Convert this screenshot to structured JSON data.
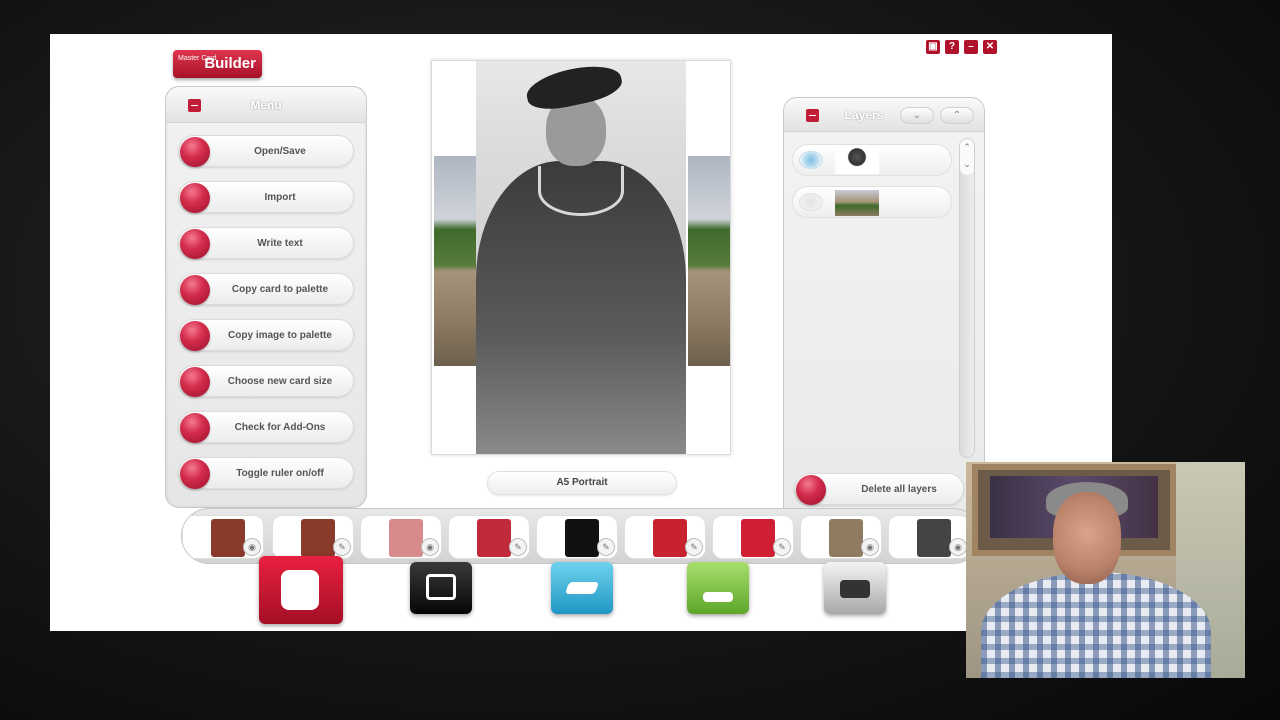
{
  "app": {
    "logo": {
      "small": "Master Card",
      "main": "Builder"
    },
    "window_controls": [
      "screen-icon",
      "help-icon",
      "minimize-icon",
      "close-icon"
    ]
  },
  "menu": {
    "title": "Menu",
    "items": [
      {
        "label": "Open/Save"
      },
      {
        "label": "Import"
      },
      {
        "label": "Write text"
      },
      {
        "label": "Copy card to palette"
      },
      {
        "label": "Copy image to palette"
      },
      {
        "label": "Choose new card size"
      },
      {
        "label": "Check for Add-Ons"
      },
      {
        "label": "Toggle ruler on/off"
      }
    ]
  },
  "canvas": {
    "size_label": "A5 Portrait"
  },
  "layers": {
    "title": "Layers",
    "items": [
      {
        "name": "sailor-boy-layer",
        "visible": true
      },
      {
        "name": "tower-background-layer",
        "visible": false
      }
    ],
    "delete_label": "Delete all layers"
  },
  "palette": {
    "items": [
      {
        "icon": "camera-icon",
        "color": "#8a3a2a"
      },
      {
        "icon": "pencil-icon",
        "color": "#8a3a2a"
      },
      {
        "icon": "camera-icon",
        "color": "#d98a8a"
      },
      {
        "icon": "pencil-icon",
        "color": "#c02a3a"
      },
      {
        "icon": "pencil-icon",
        "color": "#111111"
      },
      {
        "icon": "pencil-icon",
        "color": "#c8222e"
      },
      {
        "icon": "pencil-icon",
        "color": "#d01f34"
      },
      {
        "icon": "camera-icon",
        "color": "#8e7b62"
      },
      {
        "icon": "camera-icon",
        "color": "#444444"
      }
    ]
  },
  "tools": [
    {
      "name": "card-tool",
      "color": "#c7142f"
    },
    {
      "name": "frame-tool",
      "color": "#111111"
    },
    {
      "name": "brush-tool",
      "color": "#3eb2d6"
    },
    {
      "name": "stamp-tool",
      "color": "#7fc242"
    },
    {
      "name": "print-tool",
      "color": "#bdbdbd"
    }
  ]
}
